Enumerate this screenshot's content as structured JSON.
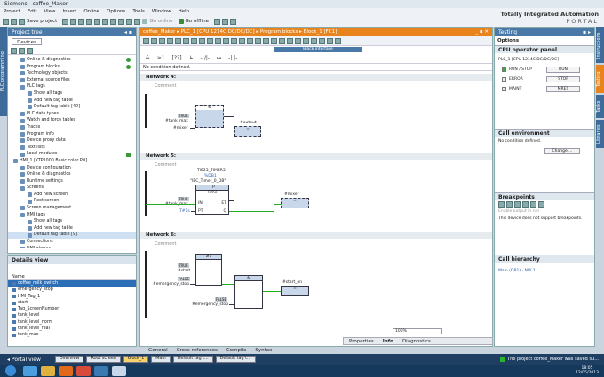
{
  "window": {
    "title": "Siemens - coffee_Maker"
  },
  "menu": [
    "Project",
    "Edit",
    "View",
    "Insert",
    "Online",
    "Options",
    "Tools",
    "Window",
    "Help"
  ],
  "toolbar": {
    "save": "Save project",
    "go_online": "Go online",
    "go_offline": "Go offline"
  },
  "brand": {
    "line1": "Totally Integrated Automation",
    "line2": "PORTAL"
  },
  "left_vtab": "PLC programming",
  "project_tree": {
    "title": "Project tree",
    "tab": "Devices",
    "items": [
      {
        "label": "Online & diagnostics",
        "indent": 1,
        "ok": true
      },
      {
        "label": "Program blocks",
        "indent": 1,
        "ok": true
      },
      {
        "label": "Technology objects",
        "indent": 1
      },
      {
        "label": "External source files",
        "indent": 1
      },
      {
        "label": "PLC tags",
        "indent": 1
      },
      {
        "label": "Show all tags",
        "indent": 2
      },
      {
        "label": "Add new tag table",
        "indent": 2
      },
      {
        "label": "Default tag table [40]",
        "indent": 2
      },
      {
        "label": "PLC data types",
        "indent": 1
      },
      {
        "label": "Watch and force tables",
        "indent": 1
      },
      {
        "label": "Traces",
        "indent": 1
      },
      {
        "label": "Program info",
        "indent": 1
      },
      {
        "label": "Device proxy data",
        "indent": 1
      },
      {
        "label": "Text lists",
        "indent": 1
      },
      {
        "label": "Local modules",
        "indent": 1,
        "check": true
      },
      {
        "label": "HMI_1 [KTP1000 Basic color PN]",
        "indent": 0
      },
      {
        "label": "Device configuration",
        "indent": 1
      },
      {
        "label": "Online & diagnostics",
        "indent": 1
      },
      {
        "label": "Runtime settings",
        "indent": 1
      },
      {
        "label": "Screens",
        "indent": 1
      },
      {
        "label": "Add new screen",
        "indent": 2
      },
      {
        "label": "Root screen",
        "indent": 2
      },
      {
        "label": "Screen management",
        "indent": 1
      },
      {
        "label": "HMI tags",
        "indent": 1
      },
      {
        "label": "Show all tags",
        "indent": 2
      },
      {
        "label": "Add new tag table",
        "indent": 2
      },
      {
        "label": "Default tag table [9]",
        "indent": 2,
        "selected": true
      },
      {
        "label": "Connections",
        "indent": 1
      },
      {
        "label": "HMI alarms",
        "indent": 1
      }
    ]
  },
  "details": {
    "title": "Details view",
    "col": "Name",
    "items": [
      {
        "label": "coffee_milk_switch",
        "selected": true
      },
      {
        "label": "emergency_stop"
      },
      {
        "label": "HMI_Tag_1"
      },
      {
        "label": "start"
      },
      {
        "label": "Tag_ScreenNumber"
      },
      {
        "label": "tank_level"
      },
      {
        "label": "tank_level_norm"
      },
      {
        "label": "tank_level_real"
      },
      {
        "label": "tank_max"
      }
    ]
  },
  "editor": {
    "breadcrumb": "coffee_Maker ▸ PLC_1 [CPU 1214C DC/DC/DC] ▸ Program blocks ▸ Block_1 [FC1]",
    "block_interface": "Block interface",
    "no_condition": "No condition defined.",
    "comment": "Comment",
    "network4": {
      "title": "Network 4:",
      "block": "&",
      "val": "TRUE",
      "in1": "#tank_max",
      "in2": "#mixer",
      "coil": "#output",
      "coil_sym": "="
    },
    "network5": {
      "title": "Network 5:",
      "db_name": "TIE25_TIMER5",
      "db_num": "%DB1",
      "db_label": "\"IEC_Timer_0_DB\"",
      "type": "TP",
      "unit": "Time",
      "in_val": "TRUE",
      "in_tag": "#tank_max",
      "pt_val": "T#1s",
      "coil": "#mixer",
      "coil_sym": "=",
      "pin_in": "IN",
      "pin_pt": "PT",
      "pin_q": "Q",
      "pin_et": "ET"
    },
    "network6": {
      "title": "Network 6:",
      "or": "≥1",
      "and": "&",
      "v1": "TRUE",
      "t1": "#start",
      "v2": "FALSE",
      "t2": "#emergency_stop",
      "v3": "FALSE",
      "t3": "#emergency_stop",
      "coil": "#start_on",
      "coil_sym": "="
    },
    "zoom": "100%"
  },
  "inspector": {
    "properties": "Properties",
    "info": "Info",
    "diagnostics": "Diagnostics"
  },
  "bottom_tabs": [
    "General",
    "Cross-references",
    "Compile",
    "Syntax"
  ],
  "testing": {
    "title": "Testing",
    "options": "Options",
    "cpu_panel": "CPU operator panel",
    "cpu_name": "PLC_1 [CPU 1214C DC/DC/DC]",
    "run_stop": "RUN / STOP",
    "error": "ERROR",
    "maint": "MAINT",
    "btn_run": "RUN",
    "btn_stop": "STOP",
    "btn_mres": "MRES",
    "call_env": "Call environment",
    "no_cond": "No condition defined.",
    "change": "Change ...",
    "breakpoints": "Breakpoints",
    "enable_out": "Enable output in run",
    "no_bp": "This device does not support breakpoints.",
    "call_hier": "Call hierarchy",
    "main_ob": "Main (OB1) - NW 1",
    "vtabs": [
      "Instructions",
      "Testing",
      "Tasks",
      "Libraries"
    ]
  },
  "portal": {
    "label": "Portal view",
    "tabs": [
      "Overview",
      "Root screen",
      "Block_1",
      "Main",
      "Default tag t...",
      "Default tag t..."
    ],
    "status": "The project coffee_Maker was saved su..."
  },
  "taskbar": {
    "time": "18:05",
    "date": "12/05/2013"
  },
  "colors": {
    "accent": "#e8841b",
    "panel": "#4a79a8",
    "portal": "#1e3e62",
    "wire": "#22aa22"
  }
}
